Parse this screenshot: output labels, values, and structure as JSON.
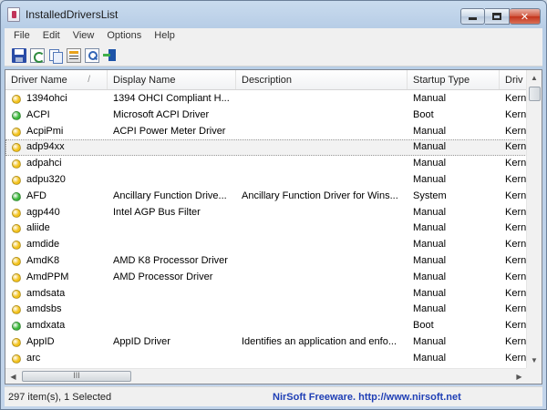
{
  "window": {
    "title": "InstalledDriversList"
  },
  "controls": {
    "minimize": "",
    "maximize": "",
    "close": "✕"
  },
  "menu": [
    "File",
    "Edit",
    "View",
    "Options",
    "Help"
  ],
  "toolbar": [
    {
      "icon": "save-icon"
    },
    {
      "icon": "refresh-icon"
    },
    {
      "icon": "copy-icon"
    },
    {
      "icon": "properties-icon"
    },
    {
      "icon": "find-icon"
    },
    {
      "icon": "exit-icon"
    }
  ],
  "colors": {
    "green": "#3cb83c",
    "yellow": "#f3c21b",
    "selected_bg": "#f2f2f2"
  },
  "columns": [
    {
      "label": "Driver Name",
      "sort": "/"
    },
    {
      "label": "Display Name"
    },
    {
      "label": "Description"
    },
    {
      "label": "Startup Type"
    },
    {
      "label": "Driv"
    }
  ],
  "rows": [
    {
      "status": "yellow",
      "cells": [
        "1394ohci",
        "1394 OHCI Compliant H...",
        "",
        "Manual",
        "Kern"
      ]
    },
    {
      "status": "green",
      "cells": [
        "ACPI",
        "Microsoft ACPI Driver",
        "",
        "Boot",
        "Kern"
      ]
    },
    {
      "status": "yellow",
      "cells": [
        "AcpiPmi",
        "ACPI Power Meter Driver",
        "",
        "Manual",
        "Kern"
      ]
    },
    {
      "status": "yellow",
      "selected": true,
      "cells": [
        "adp94xx",
        "",
        "",
        "Manual",
        "Kern"
      ]
    },
    {
      "status": "yellow",
      "cells": [
        "adpahci",
        "",
        "",
        "Manual",
        "Kern"
      ]
    },
    {
      "status": "yellow",
      "cells": [
        "adpu320",
        "",
        "",
        "Manual",
        "Kern"
      ]
    },
    {
      "status": "green",
      "cells": [
        "AFD",
        "Ancillary Function Drive...",
        "Ancillary Function Driver for Wins...",
        "System",
        "Kern"
      ]
    },
    {
      "status": "yellow",
      "cells": [
        "agp440",
        "Intel AGP Bus Filter",
        "",
        "Manual",
        "Kern"
      ]
    },
    {
      "status": "yellow",
      "cells": [
        "aliide",
        "",
        "",
        "Manual",
        "Kern"
      ]
    },
    {
      "status": "yellow",
      "cells": [
        "amdide",
        "",
        "",
        "Manual",
        "Kern"
      ]
    },
    {
      "status": "yellow",
      "cells": [
        "AmdK8",
        "AMD K8 Processor Driver",
        "",
        "Manual",
        "Kern"
      ]
    },
    {
      "status": "yellow",
      "cells": [
        "AmdPPM",
        "AMD Processor Driver",
        "",
        "Manual",
        "Kern"
      ]
    },
    {
      "status": "yellow",
      "cells": [
        "amdsata",
        "",
        "",
        "Manual",
        "Kern"
      ]
    },
    {
      "status": "yellow",
      "cells": [
        "amdsbs",
        "",
        "",
        "Manual",
        "Kern"
      ]
    },
    {
      "status": "green",
      "cells": [
        "amdxata",
        "",
        "",
        "Boot",
        "Kern"
      ]
    },
    {
      "status": "yellow",
      "cells": [
        "AppID",
        "AppID Driver",
        "Identifies an application and enfo...",
        "Manual",
        "Kern"
      ]
    },
    {
      "status": "yellow",
      "cells": [
        "arc",
        "",
        "",
        "Manual",
        "Kern"
      ]
    }
  ],
  "scroll": {
    "up": "▲",
    "down": "▼",
    "left": "◀",
    "right": "▶",
    "grip": "III"
  },
  "status": {
    "count": "297 item(s), 1 Selected",
    "link": "NirSoft Freeware.  http://www.nirsoft.net"
  }
}
